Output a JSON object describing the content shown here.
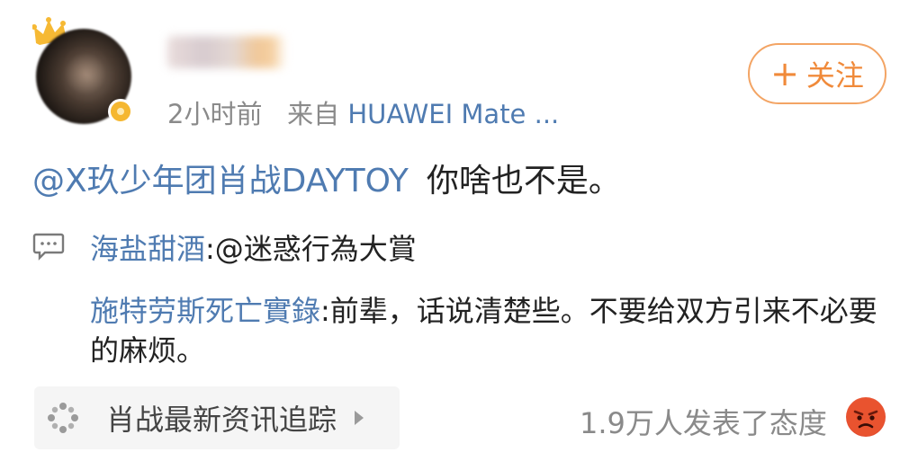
{
  "post": {
    "time": "2小时前",
    "from_label": "来自",
    "source": "HUAWEI Mate ...",
    "follow_label": "关注",
    "follow_symbol": "+",
    "mention": "@X玖少年团肖战DAYTOY",
    "text": "你啥也不是。"
  },
  "comments": [
    {
      "author": "海盐甜酒",
      "text": ":@迷惑行為大賞"
    },
    {
      "author": "施特劳斯死亡實錄",
      "text": ":前辈，话说清楚些。不要给双方引来不必要的麻烦。"
    }
  ],
  "footer": {
    "topic": "肖战最新资讯追踪",
    "reactions": "1.9万人发表了态度",
    "reaction_icon": "angry-emoji-icon"
  },
  "colors": {
    "link": "#4f7bb1",
    "follow": "#f08a3a",
    "meta": "#8a8a8a"
  }
}
